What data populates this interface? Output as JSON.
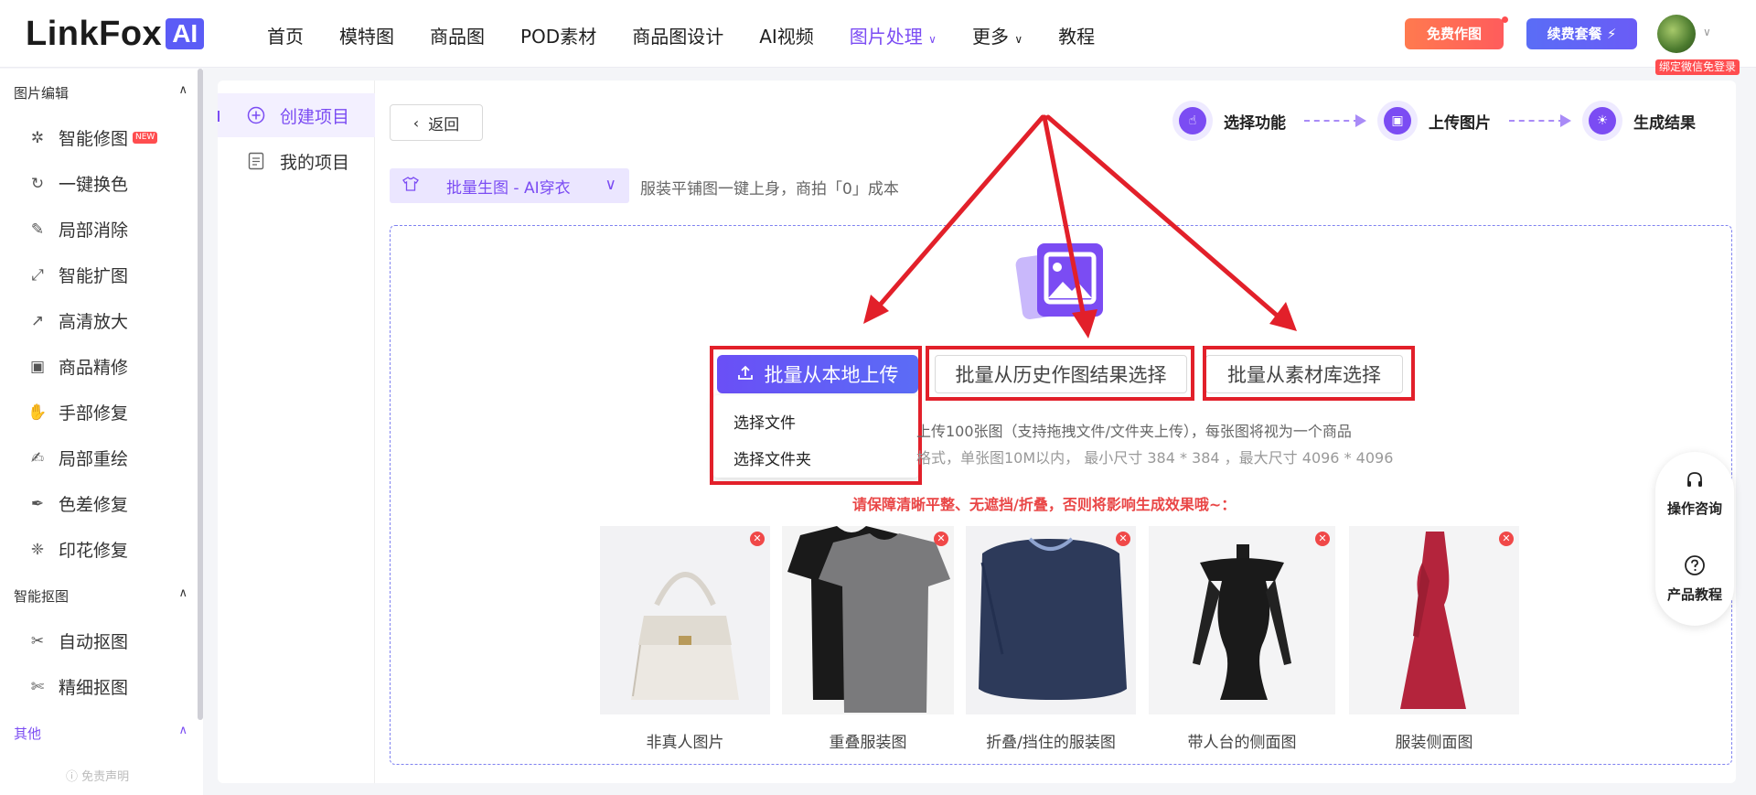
{
  "header": {
    "logo_text": "LinkFox",
    "logo_badge": "AI",
    "nav": [
      "首页",
      "模特图",
      "商品图",
      "POD素材",
      "商品图设计",
      "AI视频",
      "图片处理",
      "更多",
      "教程"
    ],
    "nav_active_index": 6,
    "free_btn": "免费作图",
    "renew_btn": "续费套餐",
    "bind_badge": "绑定微信免登录"
  },
  "sidebar": {
    "sections": [
      {
        "title": "图片编辑",
        "items": [
          {
            "label": "智能修图",
            "icon": "magic-icon",
            "badge": "NEW"
          },
          {
            "label": "一键换色",
            "icon": "color-swap-icon"
          },
          {
            "label": "局部消除",
            "icon": "eraser-icon"
          },
          {
            "label": "智能扩图",
            "icon": "expand-icon"
          },
          {
            "label": "高清放大",
            "icon": "upscale-icon"
          },
          {
            "label": "商品精修",
            "icon": "retouch-icon"
          },
          {
            "label": "手部修复",
            "icon": "hand-icon"
          },
          {
            "label": "局部重绘",
            "icon": "redraw-icon"
          },
          {
            "label": "色差修复",
            "icon": "color-fix-icon"
          },
          {
            "label": "印花修复",
            "icon": "print-fix-icon"
          }
        ]
      },
      {
        "title": "智能抠图",
        "items": [
          {
            "label": "自动抠图",
            "icon": "auto-cutout-icon"
          },
          {
            "label": "精细抠图",
            "icon": "fine-cutout-icon"
          }
        ]
      },
      {
        "title": "其他",
        "items": []
      }
    ],
    "disclaimer": "免责声明"
  },
  "subnav": {
    "items": [
      {
        "label": "创建项目",
        "icon": "plus-circle-icon",
        "active": true
      },
      {
        "label": "我的项目",
        "icon": "document-icon",
        "active": false
      }
    ]
  },
  "main": {
    "back_label": "返回",
    "steps": [
      {
        "label": "选择功能",
        "icon": "hand-pointer-icon"
      },
      {
        "label": "上传图片",
        "icon": "image-upload-icon"
      },
      {
        "label": "生成结果",
        "icon": "bulb-icon"
      }
    ],
    "function_select": "批量生图 - AI穿衣",
    "function_desc": "服装平铺图一键上身，商拍「0」成本",
    "upload_btn": "批量从本地上传",
    "history_btn": "批量从历史作图结果选择",
    "library_btn": "批量从素材库选择",
    "dropdown": [
      "选择文件",
      "选择文件夹"
    ],
    "hint1": "上传100张图（支持拖拽文件/文件夹上传），每张图将视为一个商品",
    "hint2": "格式，单张图10M以内，  最小尺寸 384 * 384 ，最大尺寸 4096 * 4096",
    "warning": "请保障清晰平整、无遮挡/折叠，否则将影响生成效果哦~：",
    "examples": [
      "非真人图片",
      "重叠服装图",
      "折叠/挡住的服装图",
      "带人台的侧面图",
      "服装侧面图"
    ]
  },
  "float": {
    "consult": "操作咨询",
    "tutorial": "产品教程"
  },
  "colors": {
    "accent": "#7b4cf3",
    "annotation": "#e2202a",
    "warning": "#e94646"
  }
}
